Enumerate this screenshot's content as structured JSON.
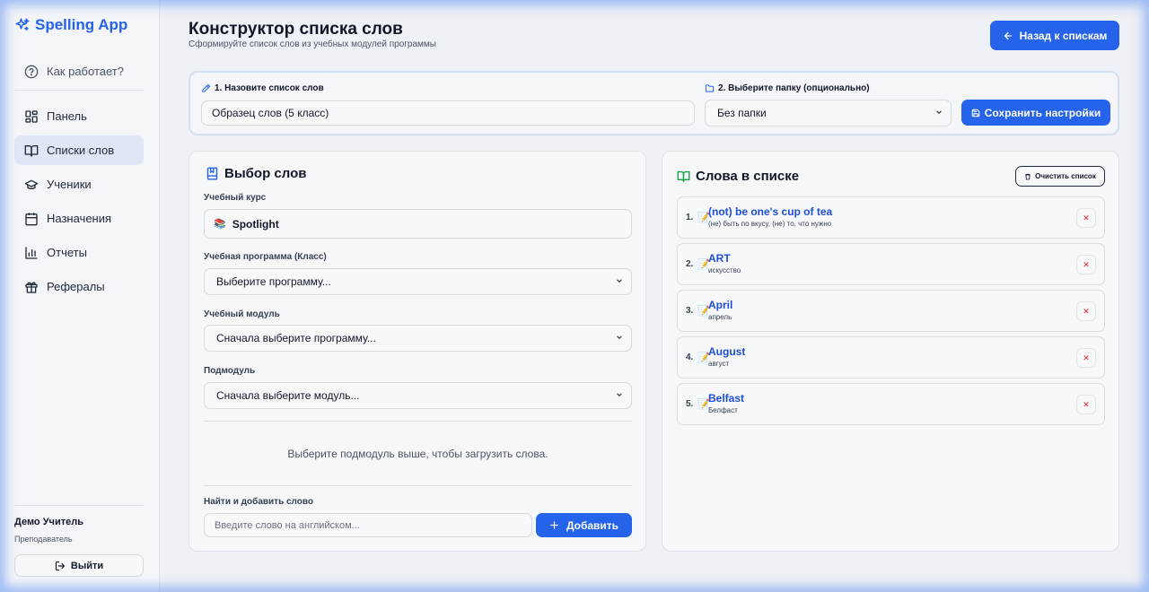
{
  "app": {
    "name": "Spelling App"
  },
  "sidebar": {
    "help": "Как работает?",
    "items": [
      {
        "label": "Панель",
        "icon": "dashboard-icon"
      },
      {
        "label": "Списки слов",
        "icon": "book-open-icon",
        "active": true
      },
      {
        "label": "Ученики",
        "icon": "graduation-cap-icon"
      },
      {
        "label": "Назначения",
        "icon": "calendar-icon"
      },
      {
        "label": "Отчеты",
        "icon": "bar-chart-icon"
      },
      {
        "label": "Рефералы",
        "icon": "gift-icon"
      }
    ],
    "user": {
      "name": "Демо Учитель",
      "role": "Преподаватель"
    },
    "logout": "Выйти"
  },
  "header": {
    "title": "Конструктор списка слов",
    "subtitle": "Сформируйте список слов из учебных модулей программы",
    "back_button": "Назад к спискам"
  },
  "settings": {
    "name_label": "1. Назовите список слов",
    "name_value": "Образец слов (5 класс)",
    "folder_label": "2. Выберите папку (опционально)",
    "folder_value": "Без папки",
    "save_button": "Сохранить настройки"
  },
  "selection": {
    "title": "Выбор слов",
    "course_label": "Учебный курс",
    "course_icon": "📚",
    "course_value": "Spotlight",
    "program_label": "Учебная программа (Класс)",
    "program_value": "Выберите программу...",
    "module_label": "Учебный модуль",
    "module_value": "Сначала выберите программу...",
    "submodule_label": "Подмодуль",
    "submodule_value": "Сначала выберите модуль...",
    "empty_message": "Выберите подмодуль выше, чтобы загрузить слова.",
    "search_label": "Найти и добавить слово",
    "search_placeholder": "Введите слово на английском...",
    "add_button": "Добавить"
  },
  "word_list": {
    "title": "Слова в списке",
    "clear_button": "Очистить список",
    "item_icon": "📝",
    "remove_glyph": "✕",
    "items": [
      {
        "num": "1.",
        "en": "(not) be one's cup of tea",
        "ru": "(не) быть по вкусу, (не) то, что нужно"
      },
      {
        "num": "2.",
        "en": "ART",
        "ru": "искусство"
      },
      {
        "num": "3.",
        "en": "April",
        "ru": "апрель"
      },
      {
        "num": "4.",
        "en": "August",
        "ru": "август"
      },
      {
        "num": "5.",
        "en": "Belfast",
        "ru": "Белфаст"
      }
    ]
  },
  "colors": {
    "accent": "#2563eb",
    "word": "#1d4ed8",
    "danger": "#dc2626",
    "list_icon": "#16a34a"
  }
}
